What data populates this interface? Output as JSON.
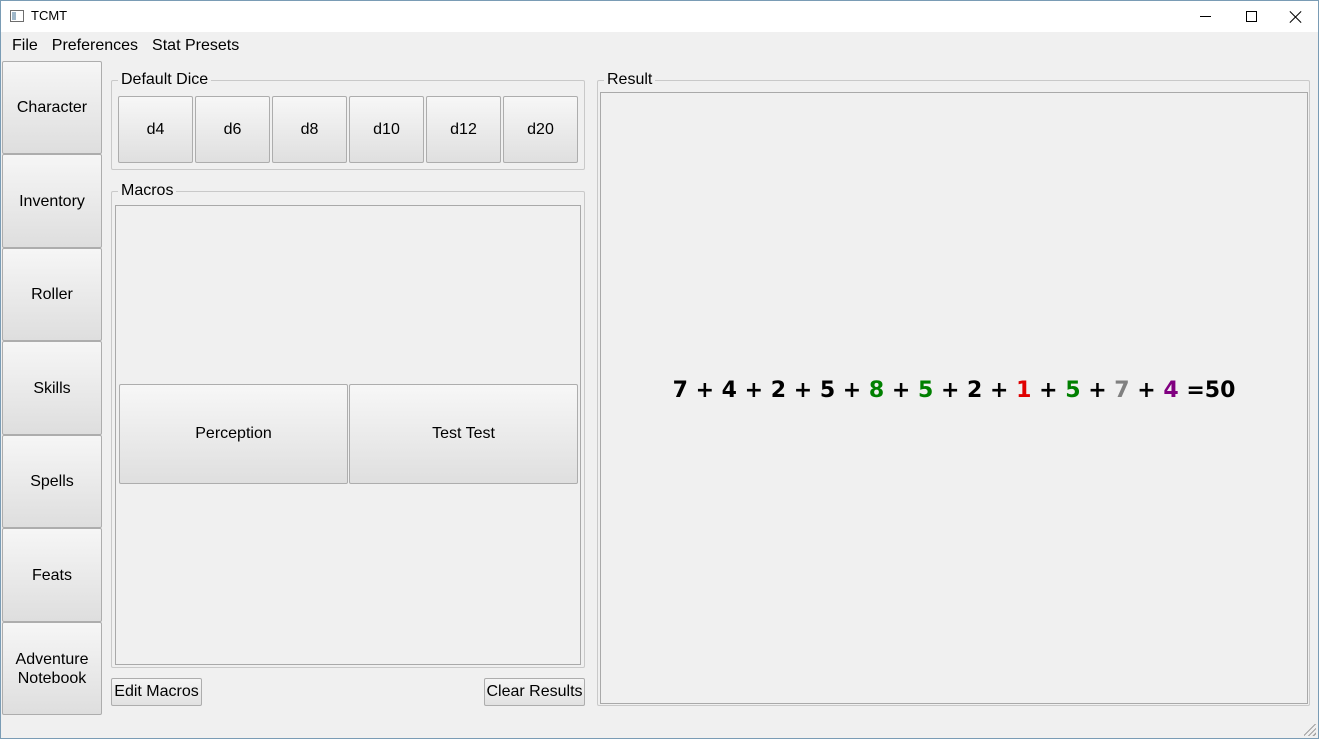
{
  "window": {
    "title": "TCMT"
  },
  "menubar": {
    "items": [
      "File",
      "Preferences",
      "Stat Presets"
    ]
  },
  "sidebar": {
    "tabs": [
      "Character",
      "Inventory",
      "Roller",
      "Skills",
      "Spells",
      "Feats",
      "Adventure\nNotebook"
    ]
  },
  "default_dice": {
    "title": "Default Dice",
    "buttons": [
      "d4",
      "d6",
      "d8",
      "d10",
      "d12",
      "d20"
    ]
  },
  "macros": {
    "title": "Macros",
    "buttons": [
      "Perception",
      "Test Test"
    ],
    "edit_label": "Edit Macros",
    "clear_label": "Clear Results"
  },
  "result": {
    "title": "Result",
    "terms": [
      {
        "value": "7",
        "color": "#000000"
      },
      {
        "value": "4",
        "color": "#000000"
      },
      {
        "value": "2",
        "color": "#000000"
      },
      {
        "value": "5",
        "color": "#000000"
      },
      {
        "value": "8",
        "color": "#008000"
      },
      {
        "value": "5",
        "color": "#008000"
      },
      {
        "value": "2",
        "color": "#000000"
      },
      {
        "value": "1",
        "color": "#e00000"
      },
      {
        "value": "5",
        "color": "#008000"
      },
      {
        "value": "7",
        "color": "#808080"
      },
      {
        "value": "4",
        "color": "#800080"
      }
    ],
    "total": "=50"
  }
}
